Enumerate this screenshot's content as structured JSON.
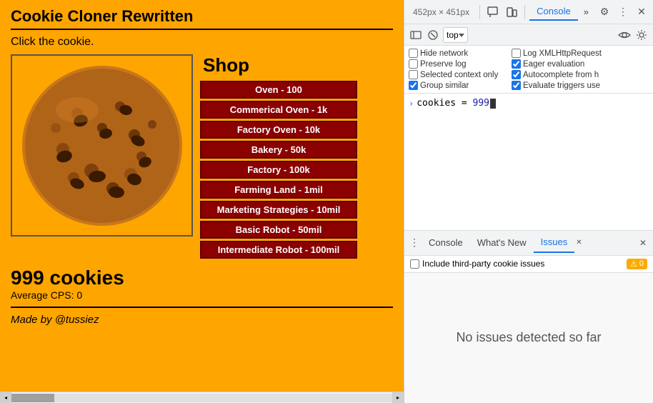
{
  "game": {
    "title": "Cookie Cloner Rewritten",
    "click_prompt": "Click the cookie.",
    "cookie_count": "999 cookies",
    "average_cps": "Average CPS: 0",
    "made_by": "Made by @tussiez"
  },
  "shop": {
    "title": "Shop",
    "items": [
      "Oven - 100",
      "Commerical Oven - 1k",
      "Factory Oven - 10k",
      "Bakery - 50k",
      "Factory - 100k",
      "Farming Land - 1mil",
      "Marketing Strategies - 10mil",
      "Basic Robot - 50mil",
      "Intermediate Robot - 100mil"
    ]
  },
  "devtools": {
    "dimensions": "452px × 451px",
    "top_tabs": {
      "console": "Console",
      "more": "»",
      "settings": "⚙",
      "menu": "⋮",
      "close": "✕"
    },
    "console_bar": {
      "dropdown_value": "top",
      "icon_eye": "👁",
      "icon_gear": "⚙"
    },
    "checkboxes": [
      {
        "label": "Hide network",
        "checked": false
      },
      {
        "label": "Log XMLHttpRequest",
        "checked": false
      },
      {
        "label": "Preserve log",
        "checked": false
      },
      {
        "label": "Eager evaluation",
        "checked": true
      },
      {
        "label": "Selected context only",
        "checked": false
      },
      {
        "label": "Autocomplete from h",
        "checked": true
      },
      {
        "label": "Group similar",
        "checked": true
      },
      {
        "label": "Evaluate triggers use",
        "checked": false
      }
    ],
    "console_output": {
      "line1_arrow": "›",
      "line1_code": "cookies = ",
      "line1_value": "999"
    },
    "bottom_tabs": {
      "console": "Console",
      "whats_new": "What's New",
      "issues": "Issues",
      "issues_close": "✕",
      "close": "✕"
    },
    "issues": {
      "include_label": "Include third-party cookie issues",
      "badge_icon": "⚠",
      "badge_count": "0"
    },
    "no_issues_text": "No issues detected so far"
  }
}
